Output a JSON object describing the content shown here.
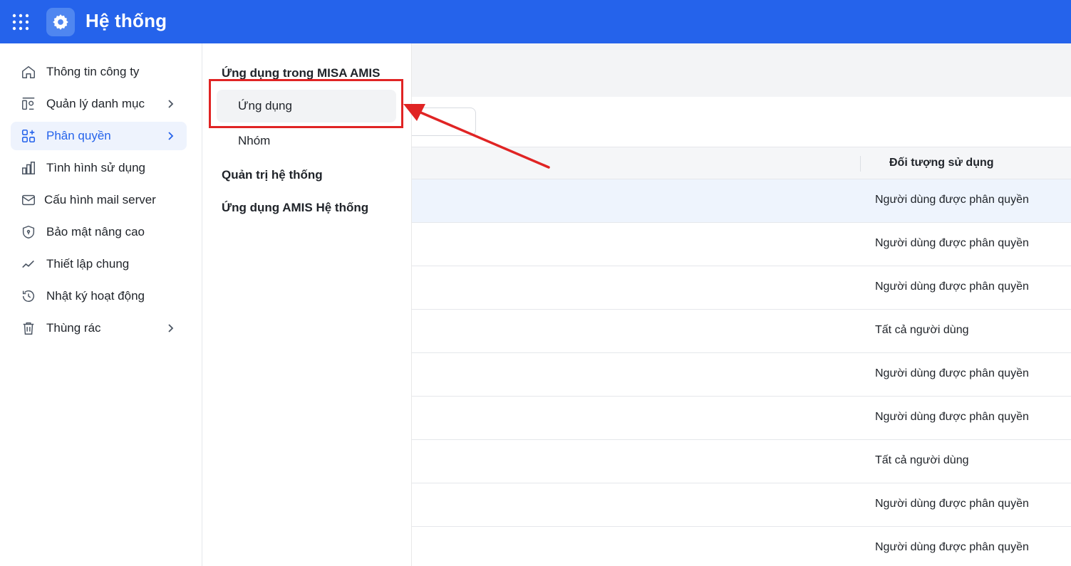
{
  "header": {
    "title": "Hệ thống",
    "apps_icon": "grid-dots-icon",
    "logo_icon": "gear-icon",
    "background": "#2563eb"
  },
  "sidebar": {
    "items": [
      {
        "label": "Thông tin công ty",
        "icon": "home-icon",
        "has_chevron": false,
        "active": false
      },
      {
        "label": "Quản lý danh mục",
        "icon": "category-icon",
        "has_chevron": true,
        "active": false
      },
      {
        "label": "Phân quyền",
        "icon": "permission-grid-icon",
        "has_chevron": true,
        "active": true
      },
      {
        "label": "Tình hình sử dụng",
        "icon": "bar-chart-icon",
        "has_chevron": false,
        "active": false
      },
      {
        "label": "Cấu hình mail server",
        "icon": "mail-icon",
        "has_chevron": false,
        "active": false
      },
      {
        "label": "Bảo mật nâng cao",
        "icon": "shield-icon",
        "has_chevron": false,
        "active": false
      },
      {
        "label": "Thiết lập chung",
        "icon": "trend-line-icon",
        "has_chevron": false,
        "active": false
      },
      {
        "label": "Nhật ký hoạt động",
        "icon": "history-icon",
        "has_chevron": false,
        "active": false
      },
      {
        "label": "Thùng rác",
        "icon": "trash-icon",
        "has_chevron": true,
        "active": false
      }
    ],
    "active_color": "#2563eb"
  },
  "submenu": {
    "group1": "Ứng dụng trong MISA AMIS",
    "items": [
      {
        "label": "Ứng dụng",
        "selected": true
      },
      {
        "label": "Nhóm",
        "selected": false
      }
    ],
    "group2": "Quản trị hệ thống",
    "group3": "Ứng dụng AMIS Hệ thống"
  },
  "table": {
    "column_header": "Đối tượng sử dụng",
    "rows": [
      "Người dùng được phân quyền",
      "Người dùng được phân quyền",
      "Người dùng được phân quyền",
      "Tất cả người dùng",
      "Người dùng được phân quyền",
      "Người dùng được phân quyền",
      "Tất cả người dùng",
      "Người dùng được phân quyền",
      "Người dùng được phân quyền"
    ]
  },
  "annotation": {
    "color": "#e02424"
  }
}
